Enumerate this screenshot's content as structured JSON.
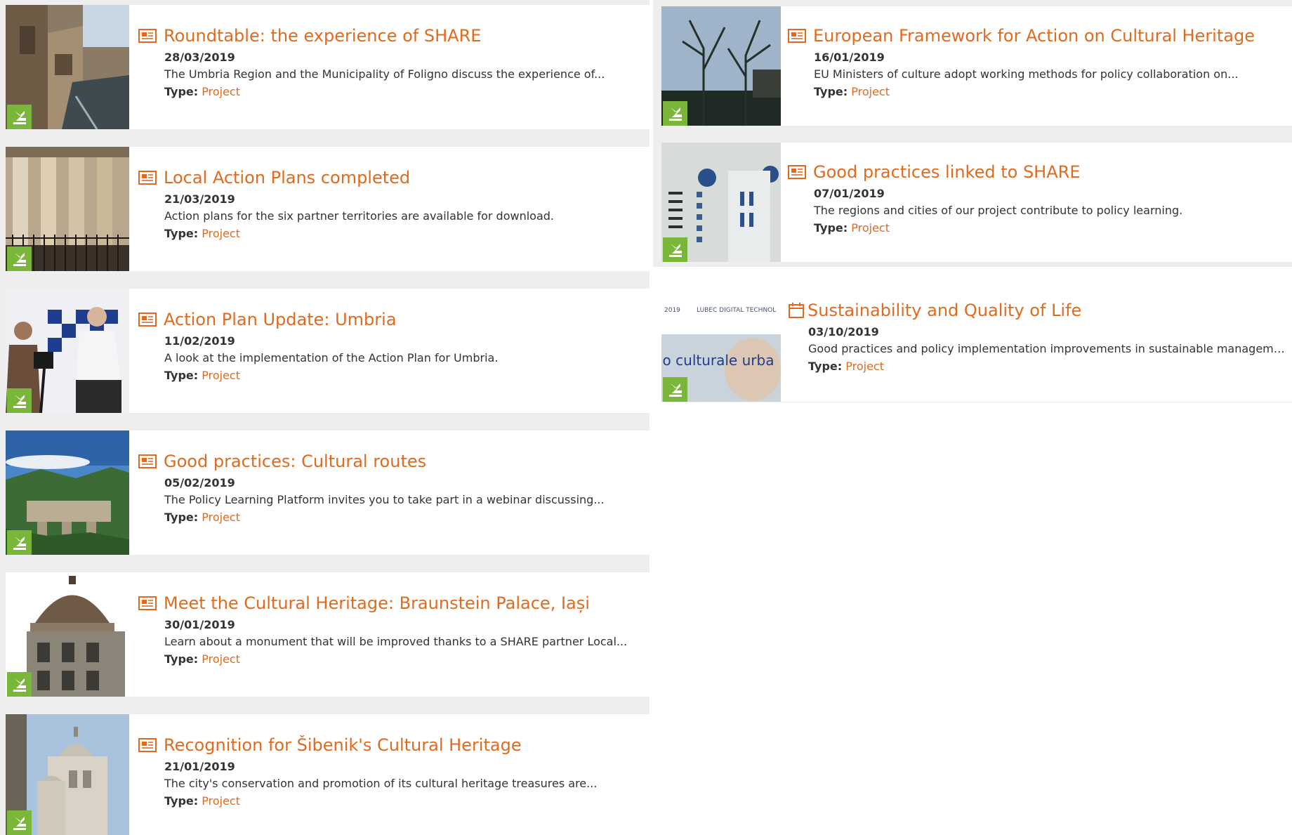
{
  "colors": {
    "accent": "#e06a1e",
    "badge": "#7ab63a",
    "separator": "#eeeeee"
  },
  "left_column": [
    {
      "title": "Roundtable: the experience of SHARE",
      "date": "28/03/2019",
      "summary": "The Umbria Region and the Municipality of Foligno discuss the experience of...",
      "type_label": "Type:",
      "type_value": "Project",
      "icon": "newspaper-icon",
      "thumb": "canal-street"
    },
    {
      "title": "Local Action Plans completed",
      "date": "21/03/2019",
      "summary": "Action plans for the six partner territories are available for download.",
      "type_label": "Type:",
      "type_value": "Project",
      "icon": "newspaper-icon",
      "thumb": "colonnade"
    },
    {
      "title": "Action Plan Update: Umbria",
      "date": "11/02/2019",
      "summary_pre": "A look at the implementation of the ",
      "summary_dotted": "Action Plan",
      "summary_post": " for Umbria.",
      "type_label": "Type:",
      "type_value": "Project",
      "icon": "newspaper-icon",
      "thumb": "interview"
    },
    {
      "title": "Good practices: Cultural routes",
      "date": "05/02/2019",
      "summary": "The Policy Learning Platform invites you to take part in a webinar discussing...",
      "type_label": "Type:",
      "type_value": "Project",
      "icon": "newspaper-icon",
      "thumb": "aqueduct"
    },
    {
      "title": "Meet the Cultural Heritage: Braunstein Palace, Iași",
      "date": "30/01/2019",
      "summary": "Learn about a monument that will be improved thanks to a SHARE partner Local...",
      "type_label": "Type:",
      "type_value": "Project",
      "icon": "newspaper-icon",
      "thumb": "palace"
    },
    {
      "title": "Recognition for Šibenik's Cultural Heritage",
      "date": "21/01/2019",
      "summary": "The city's conservation and promotion of its cultural heritage treasures are...",
      "type_label": "Type:",
      "type_value": "Project",
      "icon": "newspaper-icon",
      "thumb": "cathedral"
    }
  ],
  "right_column": [
    {
      "title": "European Framework for Action on Cultural Heritage",
      "date": "16/01/2019",
      "summary": "EU Ministers of culture adopt working methods for policy collaboration on...",
      "type_label": "Type:",
      "type_value": "Project",
      "icon": "newspaper-icon",
      "thumb": "trees"
    },
    {
      "title": "Good practices linked to SHARE",
      "date": "07/01/2019",
      "summary": "The regions and cities of our project contribute to policy learning.",
      "type_label": "Type:",
      "type_value": "Project",
      "icon": "newspaper-icon",
      "thumb": "boardgame"
    },
    {
      "title": "Sustainability and Quality of Life",
      "date": "03/10/2019",
      "summary": "Good practices and policy implementation improvements in sustainable manageme...",
      "type_label": "Type:",
      "type_value": "Project",
      "icon": "calendar-icon",
      "thumb": "banner",
      "thumb_text_top_left": "2019",
      "thumb_text_top_right": "LUBEC DIGITAL TECHNOL",
      "thumb_text_mid": "io culturale urba"
    }
  ]
}
